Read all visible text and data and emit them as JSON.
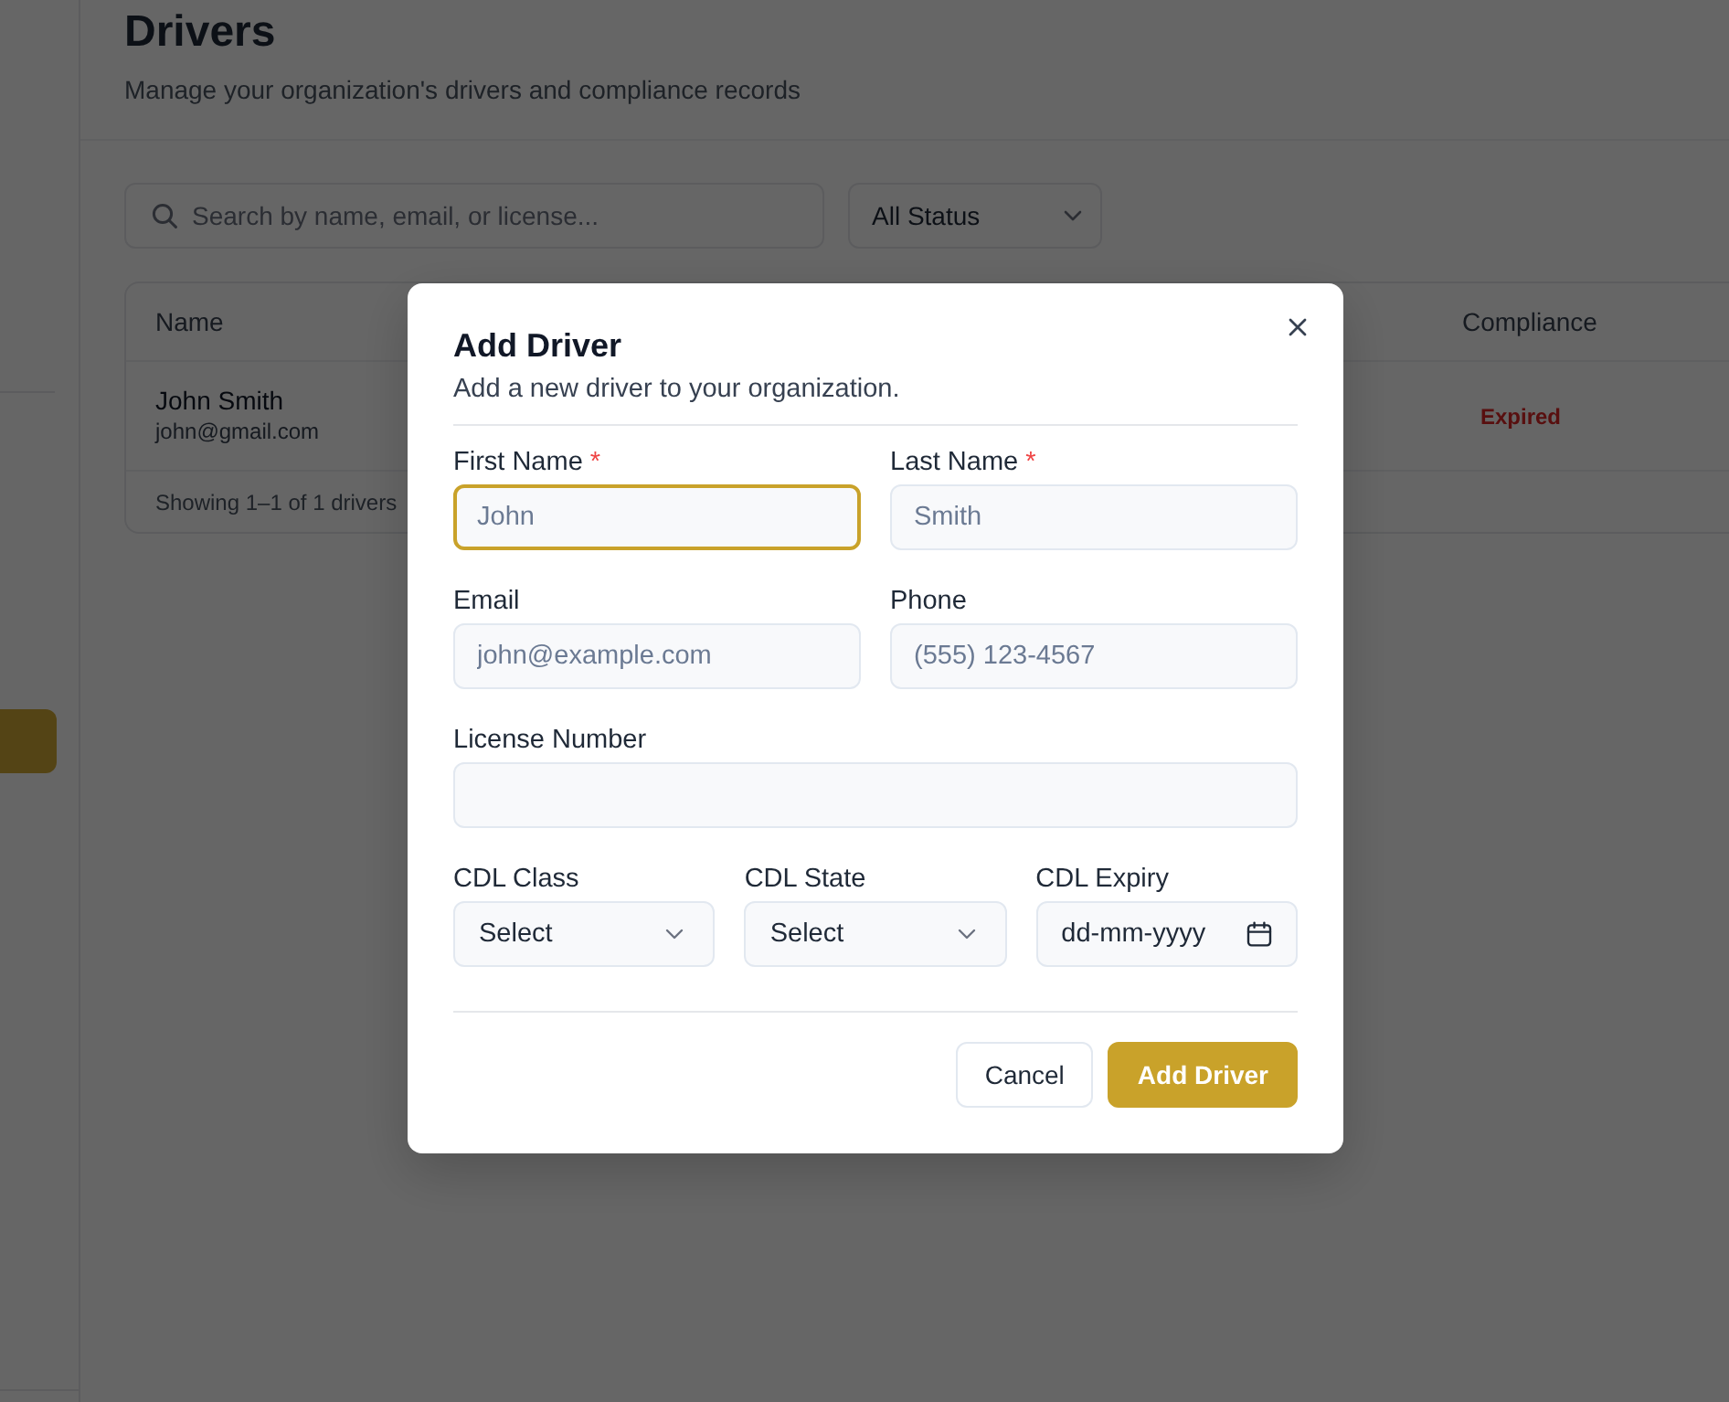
{
  "sidebar": {
    "items": [
      {
        "selected": true
      }
    ]
  },
  "page": {
    "title": "Drivers",
    "subtitle": "Manage your organization's drivers and compliance records"
  },
  "filters": {
    "search": {
      "placeholder": "Search by name, email, or license..."
    },
    "status": {
      "value": "All Status"
    }
  },
  "table": {
    "columns": [
      "Name",
      "Compliance"
    ],
    "rows": [
      {
        "name": "John Smith",
        "email": "john@gmail.com",
        "compliance": {
          "text": "Expired",
          "kind": "expired"
        }
      }
    ],
    "footer": "Showing 1–1 of 1 drivers"
  },
  "dialog": {
    "title": "Add Driver",
    "subtitle": "Add a new driver to your organization.",
    "rows": [
      [
        {
          "label": "First Name",
          "required_mark": "*",
          "kind": "text",
          "placeholder": "John",
          "focused": true
        },
        {
          "label": "Last Name",
          "required_mark": "*",
          "kind": "text",
          "placeholder": "Smith",
          "focused": false
        }
      ],
      [
        {
          "label": "Email",
          "kind": "text",
          "placeholder": "john@example.com",
          "focused": false
        },
        {
          "label": "Phone",
          "kind": "text",
          "placeholder": "(555) 123-4567",
          "focused": false
        }
      ],
      [
        {
          "label": "License Number",
          "kind": "text",
          "focused": false
        }
      ],
      [
        {
          "label": "CDL Class",
          "kind": "select",
          "value": "Select",
          "focused": false
        },
        {
          "label": "CDL State",
          "kind": "select",
          "value": "Select",
          "focused": false
        },
        {
          "label": "CDL Expiry",
          "kind": "date",
          "value": "dd-mm-yyyy",
          "focused": false
        }
      ]
    ],
    "buttons": [
      {
        "label": "Cancel",
        "kind": "secondary"
      },
      {
        "label": "Add Driver",
        "kind": "primary"
      }
    ]
  }
}
